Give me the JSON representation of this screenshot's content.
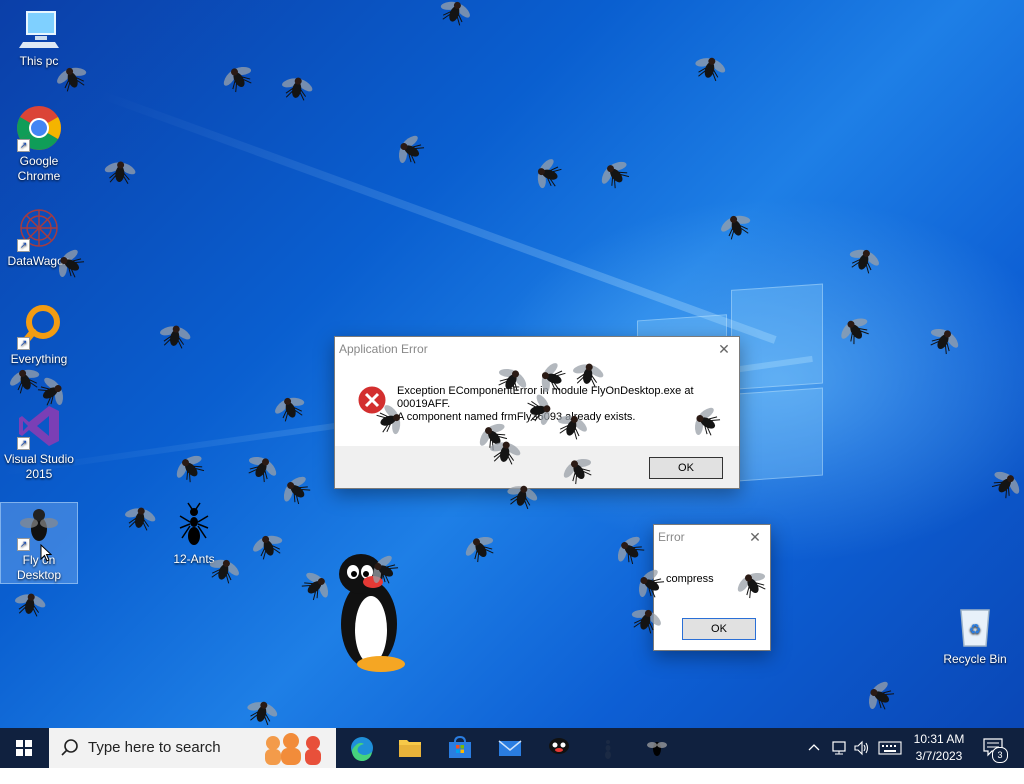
{
  "desktop_icons": {
    "this_pc": "This pc",
    "chrome_line1": "Google",
    "chrome_line2": "Chrome",
    "datawagon": "DataWagon",
    "everything": "Everything",
    "vs_line1": "Visual Studio",
    "vs_line2": "2015",
    "fly_line1": "Fly on",
    "fly_line2": "Desktop",
    "ants": "12-Ants",
    "recycle_bin": "Recycle Bin"
  },
  "app_error_dialog": {
    "title": "Application Error",
    "message_line1": "Exception EComponentError in module FlyOnDesktop.exe at",
    "message_line2": "00019AFF.",
    "message_line3": "A component named frmFly36093 already exists.",
    "ok_label": "OK"
  },
  "small_error_dialog": {
    "title": "Error",
    "message": "compress",
    "ok_label": "OK"
  },
  "taskbar": {
    "search_placeholder": "Type here to search",
    "time": "10:31 AM",
    "date": "3/7/2023",
    "notification_count": "3"
  },
  "icons": [
    "start-icon",
    "search-icon",
    "edge-icon",
    "file-explorer-icon",
    "store-icon",
    "mail-icon",
    "pingu-icon",
    "ant-icon",
    "fly-icon",
    "chevron-up-icon",
    "network-icon",
    "volume-icon",
    "keyboard-icon",
    "notification-icon",
    "error-icon"
  ],
  "colors": {
    "taskbar_bg": "#10213f",
    "desktop_blue": "#0a5fd0",
    "error_red": "#d32f2f"
  }
}
